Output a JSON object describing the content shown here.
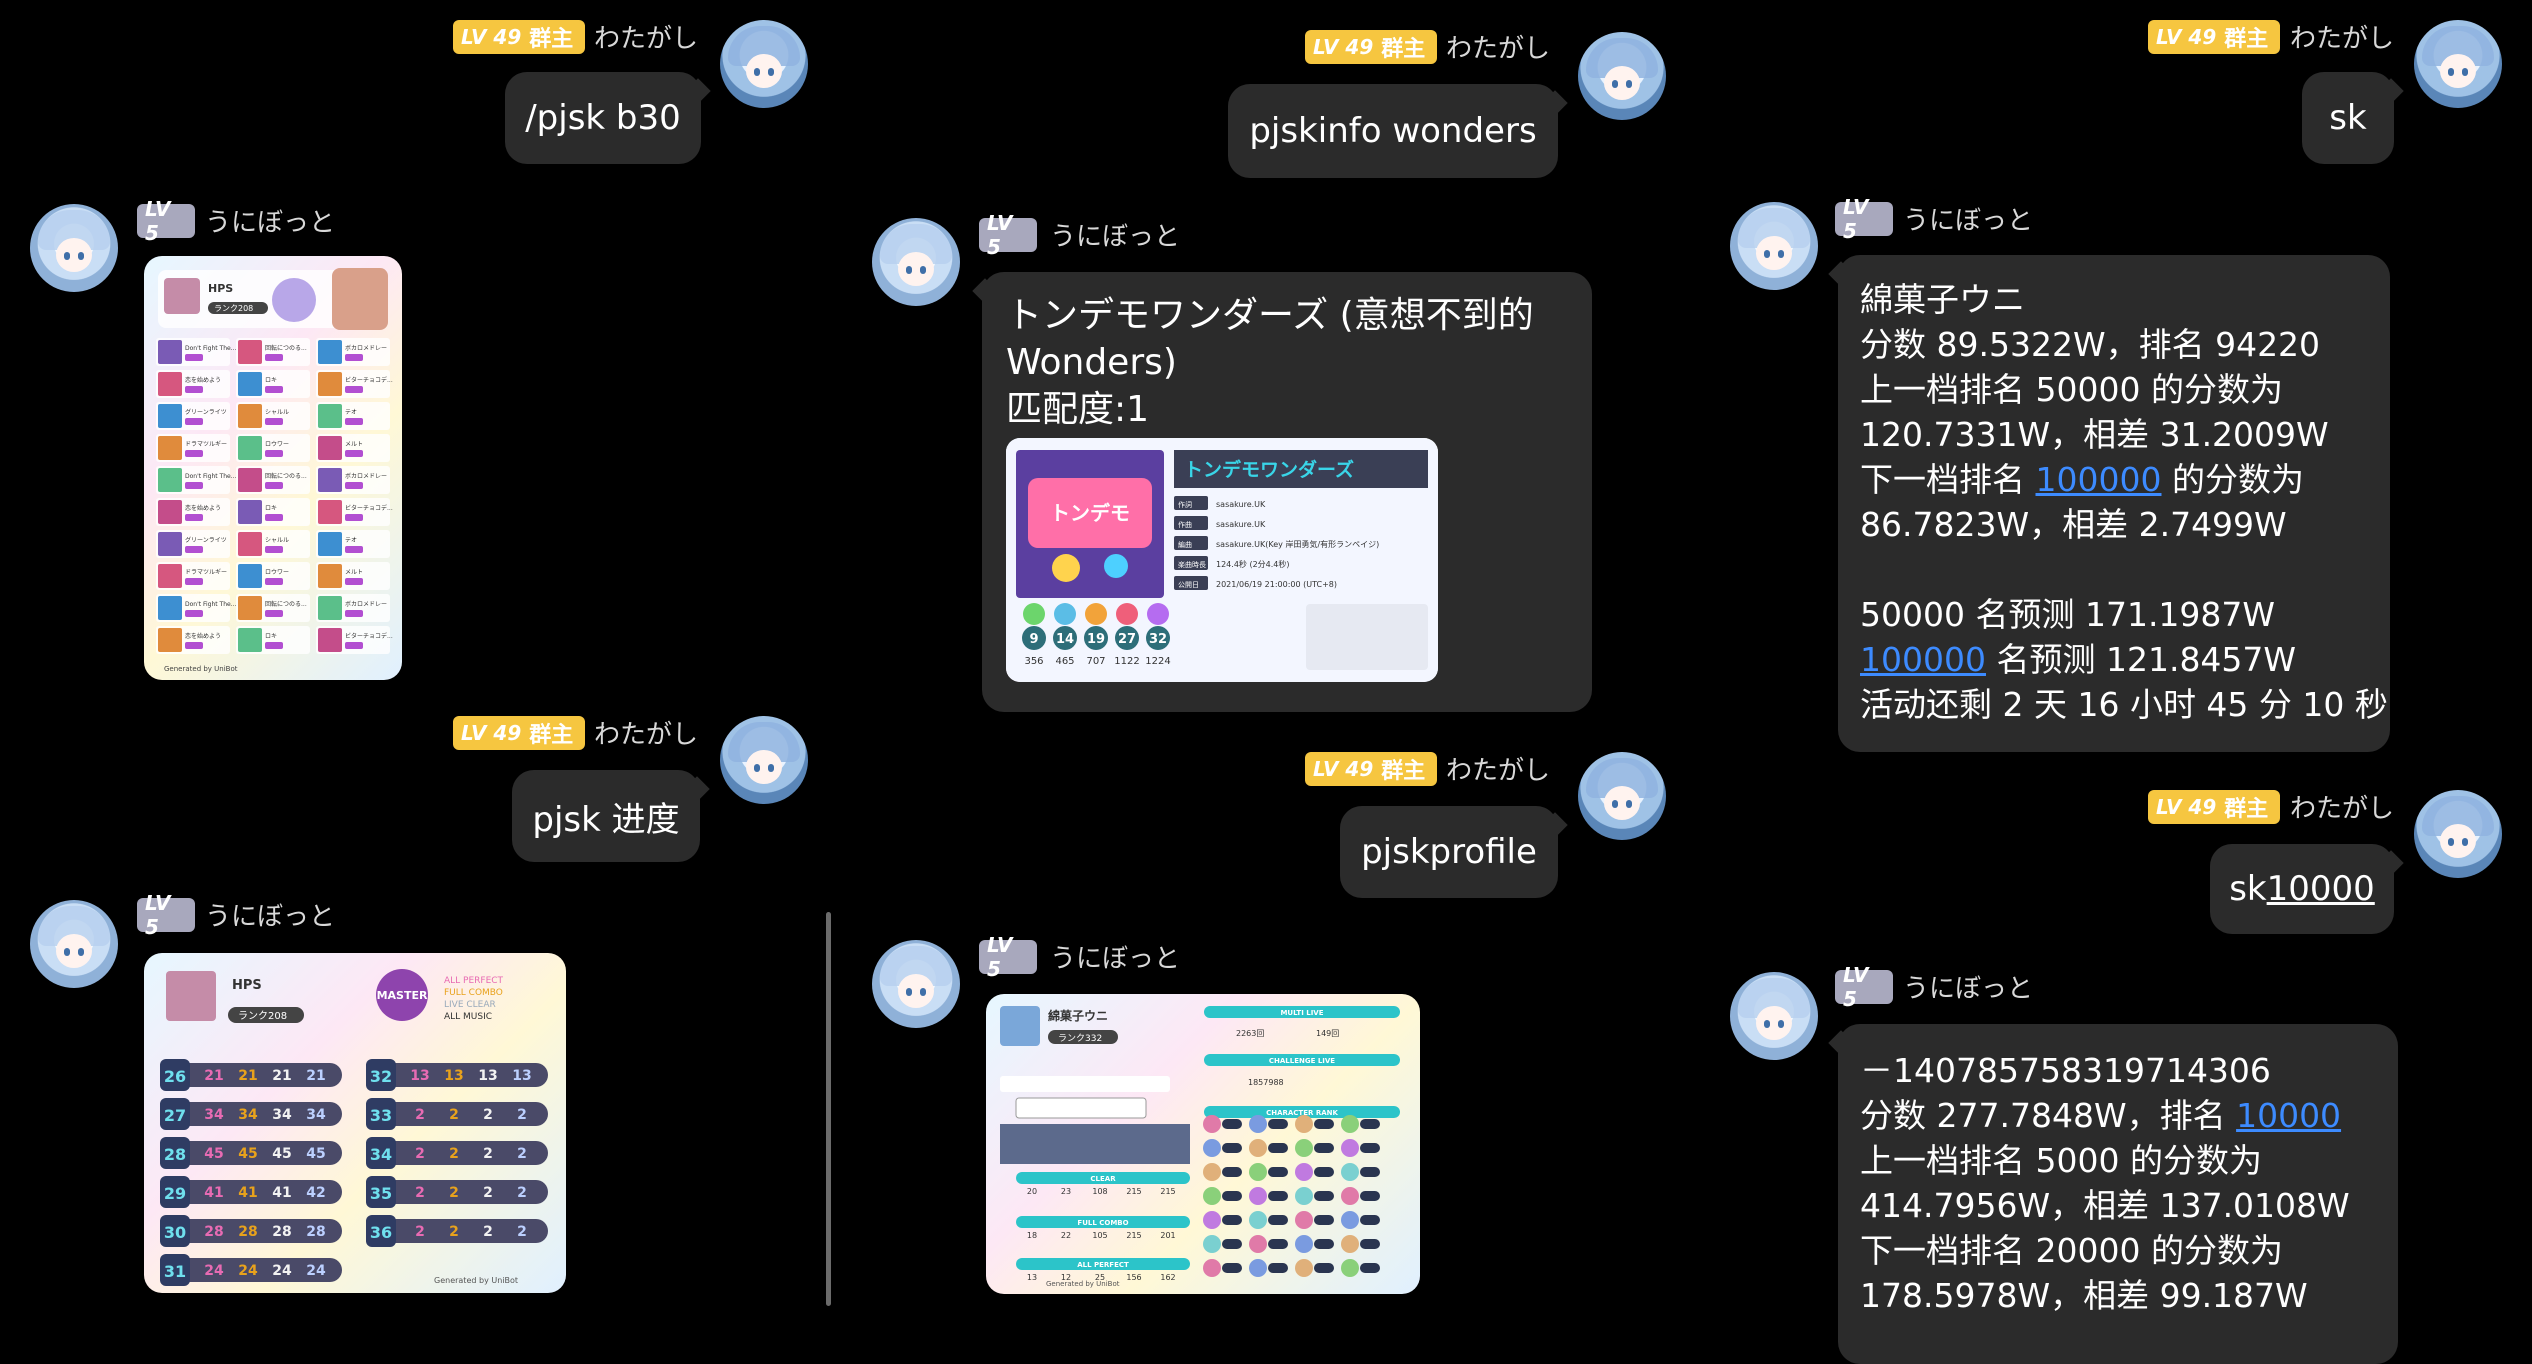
{
  "users": {
    "admin": {
      "level": "LV 49",
      "role": "群主",
      "name": "わたがし"
    },
    "bot": {
      "level": "LV 5",
      "name": "うにぼっと"
    }
  },
  "col1": {
    "cmd1": "/pjsk b30",
    "cmd2": "pjsk 进度",
    "b30_card": {
      "player": "HPS",
      "rank_label": "ランク208",
      "songs": [
        "Don't Fight The...",
        "回転につのる...",
        "ボカロメドレー",
        "恋を始めよう",
        "ロキ",
        "ビターチョコデ...",
        "グリーンライツ",
        "シャルル",
        "テオ",
        "ドラマツルギー",
        "ロウワー",
        "メルト"
      ]
    },
    "progress_card": {
      "player": "HPS",
      "rank_label": "ランク208",
      "difficulty": "MASTER",
      "legend": [
        "ALL PERFECT",
        "FULL COMBO",
        "LIVE CLEAR",
        "ALL MUSIC"
      ],
      "rows_left": [
        {
          "lv": "26",
          "v": [
            "21",
            "21",
            "21",
            "21"
          ]
        },
        {
          "lv": "27",
          "v": [
            "34",
            "34",
            "34",
            "34"
          ]
        },
        {
          "lv": "28",
          "v": [
            "45",
            "45",
            "45",
            "45"
          ]
        },
        {
          "lv": "29",
          "v": [
            "41",
            "41",
            "41",
            "42"
          ]
        },
        {
          "lv": "30",
          "v": [
            "28",
            "28",
            "28",
            "28"
          ]
        },
        {
          "lv": "31",
          "v": [
            "24",
            "24",
            "24",
            "24"
          ]
        }
      ],
      "rows_right": [
        {
          "lv": "32",
          "v": [
            "13",
            "13",
            "13",
            "13"
          ]
        },
        {
          "lv": "33",
          "v": [
            "2",
            "2",
            "2",
            "2"
          ]
        },
        {
          "lv": "34",
          "v": [
            "2",
            "2",
            "2",
            "2"
          ]
        },
        {
          "lv": "35",
          "v": [
            "2",
            "2",
            "2",
            "2"
          ]
        },
        {
          "lv": "36",
          "v": [
            "2",
            "2",
            "2",
            "2"
          ]
        }
      ],
      "footer": "Generated by UniBot"
    }
  },
  "col2": {
    "cmd1": "pjskinfo wonders",
    "reply_lines": [
      "トンデモワンダーズ (意想不到的",
      "Wonders)",
      "匹配度:1"
    ],
    "song_card": {
      "title": "トンデモワンダーズ",
      "rows": [
        {
          "k": "作詞",
          "v": "sasakure.UK"
        },
        {
          "k": "作曲",
          "v": "sasakure.UK"
        },
        {
          "k": "編曲",
          "v": "sasakure.UK(Key 岸田勇気/有形ランペイジ)"
        },
        {
          "k": "楽曲時長",
          "v": "124.4秒 (2分4.4秒)"
        },
        {
          "k": "公開日",
          "v": "2021/06/19 21:00:00 (UTC+8)"
        }
      ],
      "levels": [
        "9",
        "14",
        "19",
        "27",
        "32"
      ],
      "notes": [
        "356",
        "465",
        "707",
        "1122",
        "1224"
      ]
    },
    "cmd2": "pjskprofile",
    "profile_card": {
      "name": "綿菓子ウニ",
      "rank_label": "ランク332",
      "sections": [
        "MULTI LIVE",
        "CHALLENGE LIVE",
        "CHARACTER RANK",
        "CLEAR",
        "FULL COMBO",
        "ALL PERFECT"
      ],
      "mvp": "2263回",
      "superstar": "149回",
      "challenge_score": "1857988",
      "clear": [
        "20",
        "23",
        "108",
        "215",
        "215"
      ],
      "fc": [
        "18",
        "22",
        "105",
        "215",
        "201"
      ],
      "ap": [
        "13",
        "12",
        "25",
        "156",
        "162"
      ],
      "footer": "Generated by UniBot"
    }
  },
  "col3": {
    "cmd1": "sk",
    "reply1": {
      "name": "綿菓子ウニ",
      "l1": "分数 89.5322W，排名 94220",
      "l2": "上一档排名 50000 的分数为",
      "l3": "120.7331W，相差 31.2009W",
      "l4_pre": "下一档排名 ",
      "l4_link": "100000",
      "l4_post": " 的分数为",
      "l5": "86.7823W，相差 2.7499W",
      "l6": "50000 名预测 171.1987W",
      "l7_link": "100000",
      "l7_post": " 名预测 121.8457W",
      "l8": "活动还剩 2 天 16 小时 45 分 10 秒"
    },
    "cmd2_pre": "sk",
    "cmd2_link": "10000",
    "reply2": {
      "l1": "－140785758319714306",
      "l2_pre": "分数 277.7848W，排名 ",
      "l2_link": "10000",
      "l3": "上一档排名 5000 的分数为",
      "l4": "414.7956W，相差 137.0108W",
      "l5": "下一档排名 20000 的分数为",
      "l6": "178.5978W，相差 99.187W"
    }
  },
  "colors": {
    "bubble": "#2b2b2b",
    "admin_badge": "#f6c640",
    "bot_badge": "#a8a8bd",
    "link": "#3d8bff"
  }
}
